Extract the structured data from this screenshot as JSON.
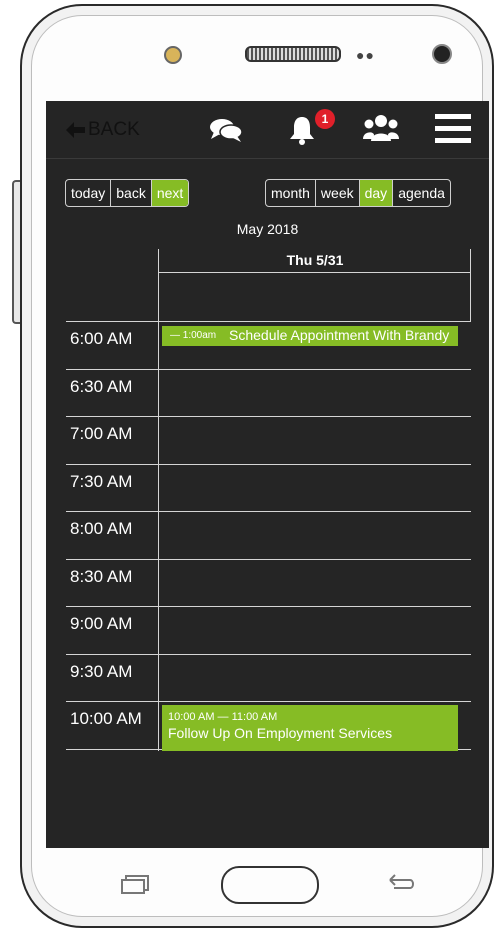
{
  "header": {
    "back_label": "BACK",
    "notification_count": "1"
  },
  "toolbar": {
    "today_label": "today",
    "back_label": "back",
    "next_label": "next",
    "month_label": "month",
    "week_label": "week",
    "day_label": "day",
    "agenda_label": "agenda",
    "active_view": "day"
  },
  "calendar": {
    "title": "May 2018",
    "day_header": "Thu 5/31",
    "slots": [
      "6:00 AM",
      "6:30 AM",
      "7:00 AM",
      "7:30 AM",
      "8:00 AM",
      "8:30 AM",
      "9:00 AM",
      "9:30 AM",
      "10:00 AM"
    ],
    "events": [
      {
        "time": "— 1:00am",
        "title": "Schedule Appointment With Brandy Wright"
      },
      {
        "time": "10:00 AM — 11:00 AM",
        "title": "Follow Up On Employment Services"
      }
    ]
  },
  "colors": {
    "accent": "#86bc25",
    "screen_bg": "#252525",
    "badge": "#e0202a"
  },
  "icons": [
    "arrow-left-icon",
    "chat-icon",
    "bell-icon",
    "group-icon",
    "hamburger-menu-icon",
    "recent-apps-icon",
    "home-button",
    "back-nav-icon"
  ]
}
